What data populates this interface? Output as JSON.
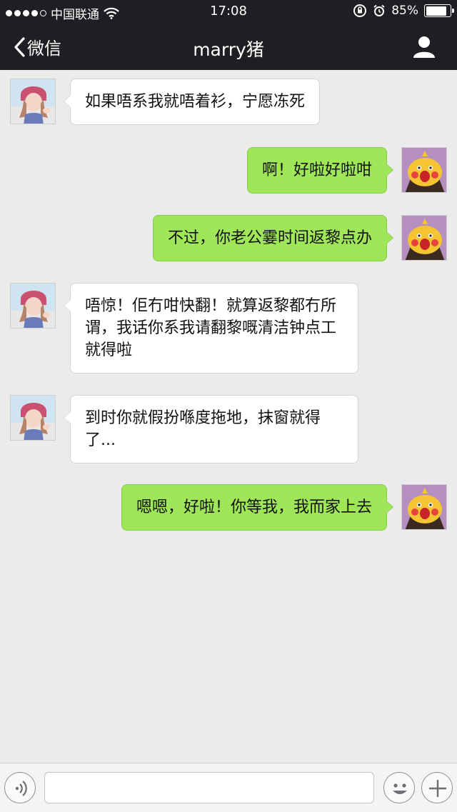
{
  "status_bar": {
    "carrier": "中国联通",
    "time": "17:08",
    "battery_text": "85%",
    "battery_level": 0.85,
    "signal_dots_filled": 4,
    "signal_dots_total": 5,
    "icons": [
      "wifi-icon",
      "orientation-lock-icon",
      "alarm-icon",
      "battery-icon"
    ]
  },
  "nav": {
    "back_label": "微信",
    "title": "marry猪",
    "right_icon": "person-icon"
  },
  "messages": [
    {
      "sender": "her",
      "text": "如果唔系我就唔着衫，宁愿冻死"
    },
    {
      "sender": "me",
      "text": "啊！好啦好啦咁"
    },
    {
      "sender": "me",
      "text": "不过，你老公霎时间返黎点办"
    },
    {
      "sender": "her",
      "text": "唔惊！佢冇咁快翻！就算返黎都冇所谓，我话你系我请翻黎嘅清洁钟点工就得啦"
    },
    {
      "sender": "her",
      "text": "到时你就假扮喺度拖地，抹窗就得了..."
    },
    {
      "sender": "me",
      "text": "嗯嗯，好啦！你等我，我而家上去"
    }
  ],
  "input_bar": {
    "value": "",
    "icons": [
      "voice-icon",
      "emoji-icon",
      "plus-icon"
    ]
  },
  "colors": {
    "nav_bg": "#1f1f23",
    "chat_bg": "#ebebeb",
    "outgoing_bubble": "#9fe658",
    "incoming_bubble": "#ffffff"
  }
}
